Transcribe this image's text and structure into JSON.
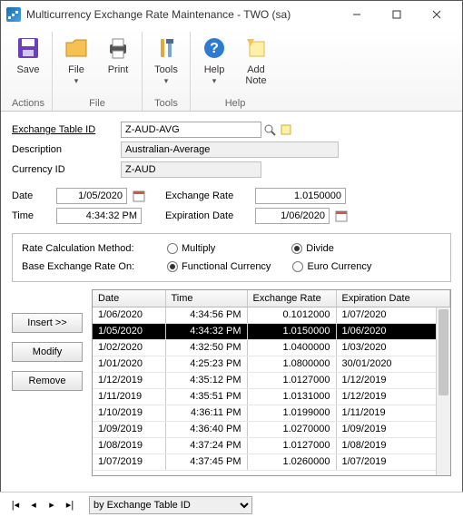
{
  "titlebar": {
    "title": "Multicurrency Exchange Rate Maintenance  -  TWO (sa)"
  },
  "ribbon": {
    "save": "Save",
    "file": "File",
    "print": "Print",
    "tools": "Tools",
    "help": "Help",
    "addnote": "Add\nNote",
    "group_actions": "Actions",
    "group_file": "File",
    "group_tools": "Tools",
    "group_help": "Help"
  },
  "form": {
    "labels": {
      "exchange_table_id": "Exchange Table ID",
      "description": "Description",
      "currency_id": "Currency ID",
      "date": "Date",
      "time": "Time",
      "exchange_rate": "Exchange Rate",
      "expiration_date": "Expiration Date"
    },
    "values": {
      "exchange_table_id": "Z-AUD-AVG",
      "description": "Australian-Average",
      "currency_id": "Z-AUD",
      "date": "1/05/2020",
      "time": "4:34:32 PM",
      "exchange_rate": "1.0150000",
      "expiration_date": "1/06/2020"
    }
  },
  "options": {
    "labels": {
      "calc_method": "Rate Calculation Method:",
      "base_on": "Base Exchange Rate On:",
      "multiply": "Multiply",
      "divide": "Divide",
      "functional": "Functional Currency",
      "euro": "Euro Currency"
    }
  },
  "buttons": {
    "insert": "Insert >>",
    "modify": "Modify",
    "remove": "Remove"
  },
  "table": {
    "headers": {
      "date": "Date",
      "time": "Time",
      "rate": "Exchange Rate",
      "exp": "Expiration Date"
    },
    "rows": [
      {
        "date": "1/06/2020",
        "time": "4:34:56 PM",
        "rate": "0.1012000",
        "exp": "1/07/2020",
        "sel": false
      },
      {
        "date": "1/05/2020",
        "time": "4:34:32 PM",
        "rate": "1.0150000",
        "exp": "1/06/2020",
        "sel": true
      },
      {
        "date": "1/02/2020",
        "time": "4:32:50 PM",
        "rate": "1.0400000",
        "exp": "1/03/2020",
        "sel": false
      },
      {
        "date": "1/01/2020",
        "time": "4:25:23 PM",
        "rate": "1.0800000",
        "exp": "30/01/2020",
        "sel": false
      },
      {
        "date": "1/12/2019",
        "time": "4:35:12 PM",
        "rate": "1.0127000",
        "exp": "1/12/2019",
        "sel": false
      },
      {
        "date": "1/11/2019",
        "time": "4:35:51 PM",
        "rate": "1.0131000",
        "exp": "1/12/2019",
        "sel": false
      },
      {
        "date": "1/10/2019",
        "time": "4:36:11 PM",
        "rate": "1.0199000",
        "exp": "1/11/2019",
        "sel": false
      },
      {
        "date": "1/09/2019",
        "time": "4:36:40 PM",
        "rate": "1.0270000",
        "exp": "1/09/2019",
        "sel": false
      },
      {
        "date": "1/08/2019",
        "time": "4:37:24 PM",
        "rate": "1.0127000",
        "exp": "1/08/2019",
        "sel": false
      },
      {
        "date": "1/07/2019",
        "time": "4:37:45 PM",
        "rate": "1.0260000",
        "exp": "1/07/2019",
        "sel": false
      }
    ]
  },
  "footer": {
    "select": "by Exchange Table ID"
  }
}
